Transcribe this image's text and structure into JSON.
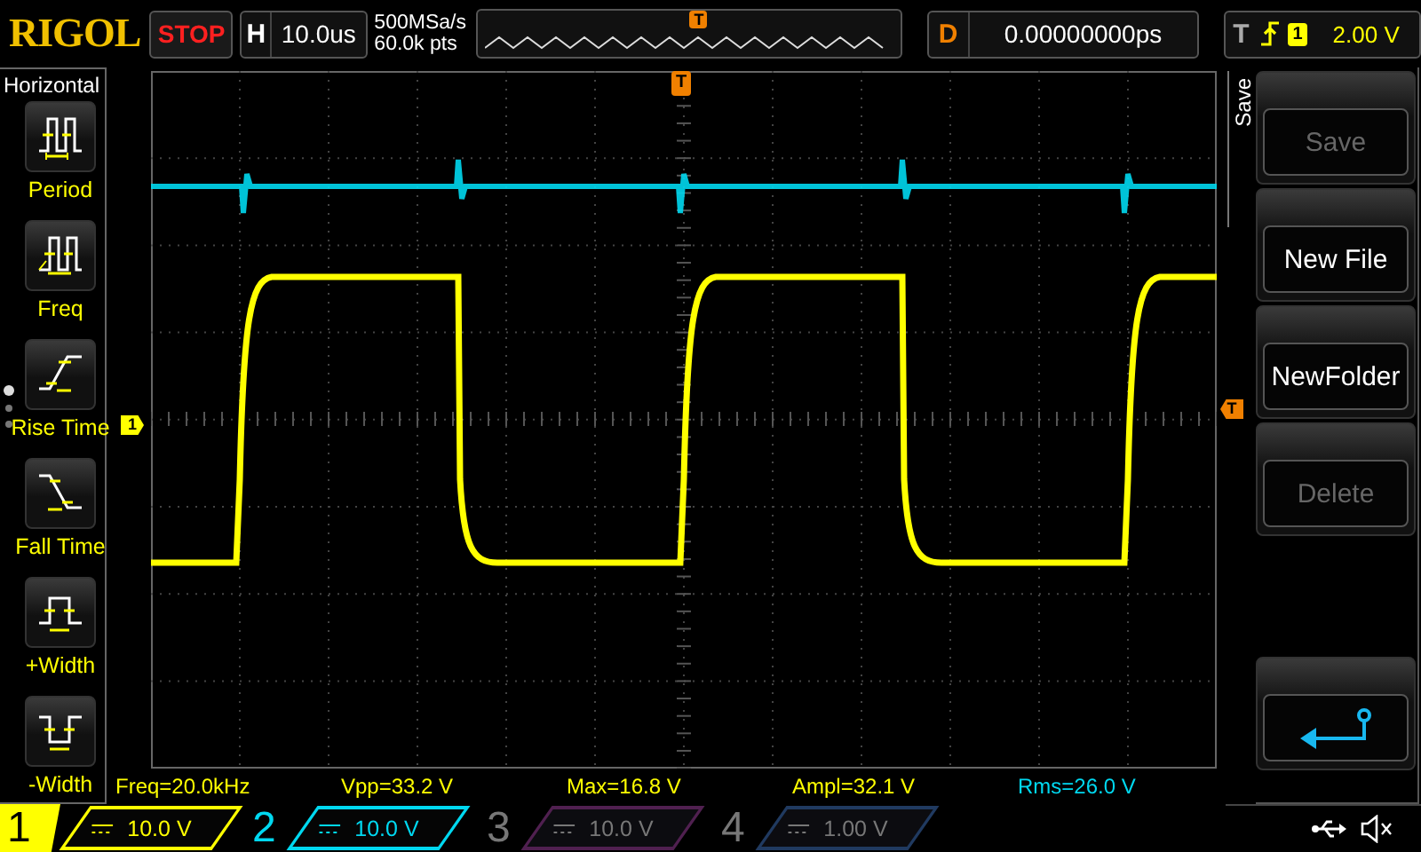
{
  "top_bar": {
    "logo": "RIGOL",
    "run_state": "STOP",
    "timebase": {
      "label": "H",
      "value": "10.0us"
    },
    "sample_rate": "500MSa/s",
    "memory_depth": "60.0k pts",
    "overview": {
      "trigger_mark": "T"
    },
    "delay": {
      "label": "D",
      "value": "0.00000000ps"
    },
    "trigger": {
      "label": "T",
      "source": "1",
      "level": "2.00 V"
    }
  },
  "measure_menu": {
    "title": "Horizontal",
    "items": [
      {
        "label": "Period"
      },
      {
        "label": "Freq"
      },
      {
        "label": "Rise Time"
      },
      {
        "label": "Fall Time"
      },
      {
        "label": "+Width"
      },
      {
        "label": "-Width"
      }
    ],
    "pages": [
      {
        "selected": true
      },
      {
        "selected": false
      },
      {
        "selected": false
      }
    ]
  },
  "display": {
    "trigger_position_mark": "T",
    "trigger_level_mark": "T",
    "channel_mark": "1"
  },
  "measurements": [
    {
      "text": "Freq=20.0kHz",
      "color": "#ffff00"
    },
    {
      "text": "Vpp=33.2 V",
      "color": "#ffff00"
    },
    {
      "text": "Max=16.8 V",
      "color": "#ffff00"
    },
    {
      "text": "Ampl=32.1 V",
      "color": "#ffff00"
    },
    {
      "text": "Rms=26.0 V",
      "color": "#00d8f0"
    }
  ],
  "save_menu": {
    "title": "Save",
    "buttons": [
      {
        "kind": "text",
        "label": "Save",
        "disabled": true
      },
      {
        "kind": "text",
        "label": "New File",
        "disabled": false
      },
      {
        "kind": "text",
        "label": "NewFolder",
        "disabled": false
      },
      {
        "kind": "text",
        "label": "Delete",
        "disabled": true
      },
      {
        "kind": "back",
        "disabled": false
      }
    ]
  },
  "channels": [
    {
      "number": "1",
      "scale": "10.0 V",
      "color": "#ffff00",
      "on": true,
      "selected": true
    },
    {
      "number": "2",
      "scale": "10.0 V",
      "color": "#00d8f0",
      "on": true,
      "selected": false
    },
    {
      "number": "3",
      "scale": "10.0 V",
      "color": "#502050",
      "on": false,
      "selected": false
    },
    {
      "number": "4",
      "scale": "1.00 V",
      "color": "#203a60",
      "on": false,
      "selected": false
    }
  ]
}
